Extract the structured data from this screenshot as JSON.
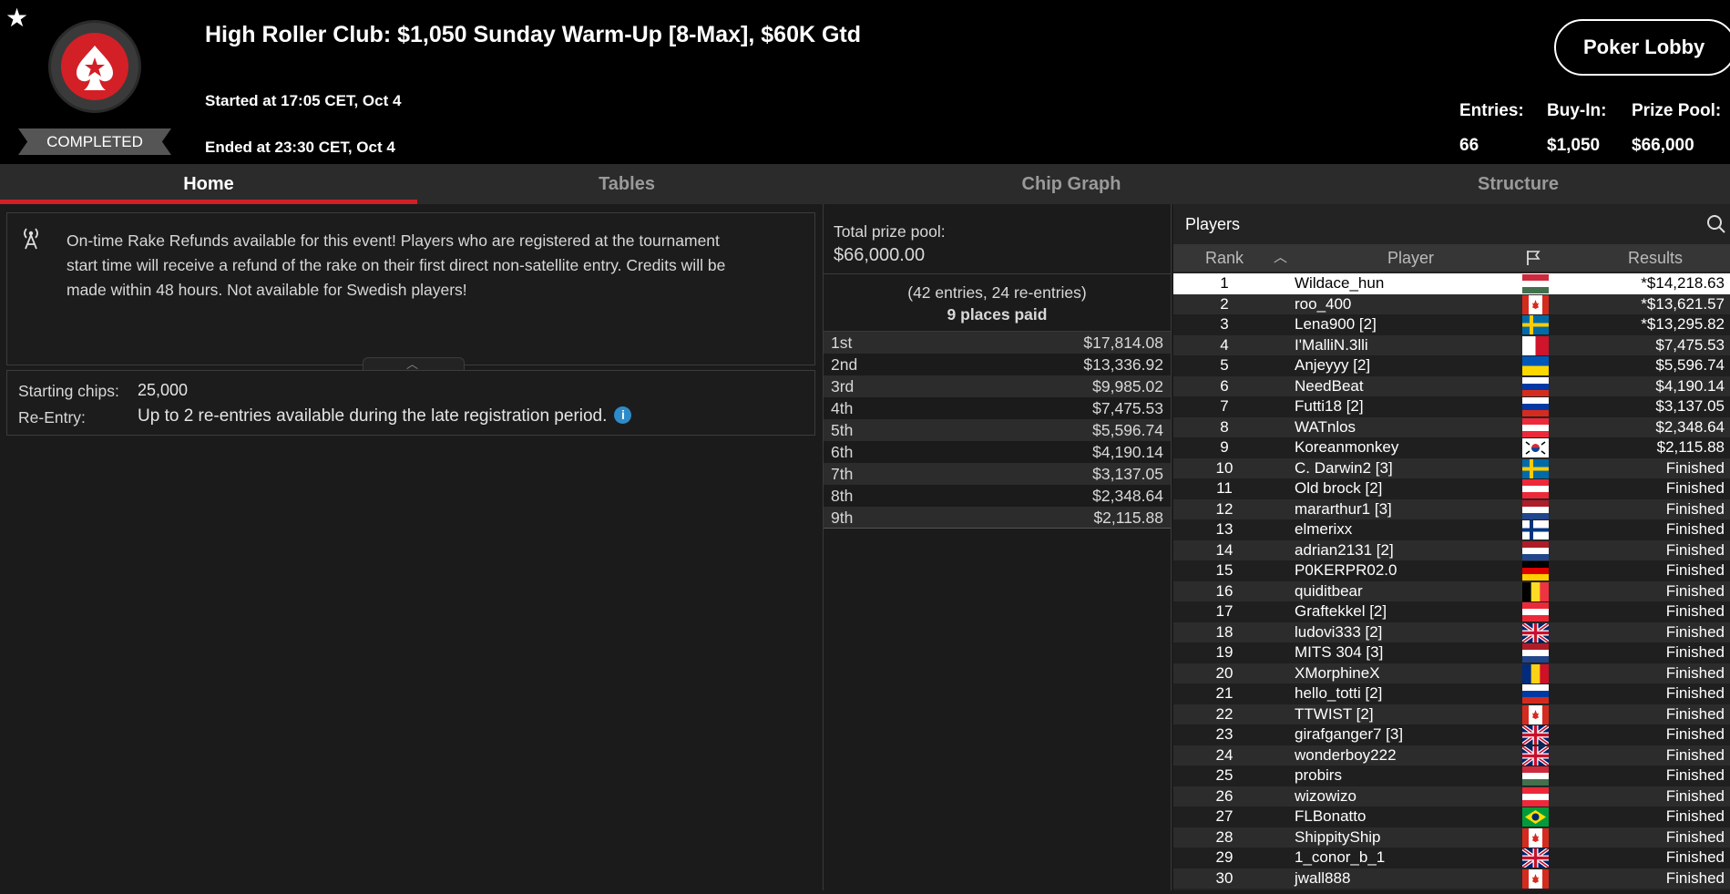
{
  "header": {
    "title": "High Roller Club: $1,050 Sunday Warm-Up [8-Max], $60K Gtd",
    "started": "Started at 17:05 CET, Oct 4",
    "ended": "Ended at 23:30 CET, Oct 4",
    "status": "COMPLETED",
    "lobby_button": "Poker Lobby",
    "stats": {
      "entries_label": "Entries:",
      "entries_value": "66",
      "buyin_label": "Buy-In:",
      "buyin_value": "$1,050",
      "prizepool_label": "Prize Pool:",
      "prizepool_value": "$66,000"
    },
    "accent_color": "#d31f26"
  },
  "tabs": [
    {
      "label": "Home",
      "active": true
    },
    {
      "label": "Tables"
    },
    {
      "label": "Chip Graph"
    },
    {
      "label": "Structure"
    }
  ],
  "notice": {
    "icon": "antenna-icon",
    "lines": [
      "On-time Rake Refunds available for this event! Players who are registered at the tournament",
      "start time will receive a refund of the rake on their first direct non-satellite entry. Credits will be",
      "made within 48 hours. Not available for Swedish players!"
    ]
  },
  "details": {
    "starting_label": "Starting chips:",
    "starting_value": "25,000",
    "reentry_label": "Re-Entry:",
    "reentry_value": "Up to 2 re-entries available during the late registration period."
  },
  "prizes": {
    "total_label": "Total prize pool:",
    "total_value": "$66,000.00",
    "entries_note": "(42 entries, 24 re-entries)",
    "places_paid": "9 places paid",
    "rows": [
      {
        "place": "1st",
        "amount": "$17,814.08"
      },
      {
        "place": "2nd",
        "amount": "$13,336.92"
      },
      {
        "place": "3rd",
        "amount": "$9,985.02"
      },
      {
        "place": "4th",
        "amount": "$7,475.53"
      },
      {
        "place": "5th",
        "amount": "$5,596.74"
      },
      {
        "place": "6th",
        "amount": "$4,190.14"
      },
      {
        "place": "7th",
        "amount": "$3,137.05"
      },
      {
        "place": "8th",
        "amount": "$2,348.64"
      },
      {
        "place": "9th",
        "amount": "$2,115.88"
      }
    ]
  },
  "players": {
    "title": "Players",
    "columns": {
      "rank": "Rank",
      "player": "Player",
      "results": "Results"
    },
    "rows": [
      {
        "rank": "1",
        "name": "Wildace_hun",
        "flag": "hu",
        "result": "*$14,218.63"
      },
      {
        "rank": "2",
        "name": "roo_400",
        "flag": "ca",
        "result": "*$13,621.57"
      },
      {
        "rank": "3",
        "name": "Lena900 [2]",
        "flag": "se",
        "result": "*$13,295.82"
      },
      {
        "rank": "4",
        "name": "I'MalliN.3lli",
        "flag": "mt",
        "result": "$7,475.53"
      },
      {
        "rank": "5",
        "name": "Anjeyyy [2]",
        "flag": "ua",
        "result": "$5,596.74"
      },
      {
        "rank": "6",
        "name": "NeedBeat",
        "flag": "ru",
        "result": "$4,190.14"
      },
      {
        "rank": "7",
        "name": "Futti18 [2]",
        "flag": "ru",
        "result": "$3,137.05"
      },
      {
        "rank": "8",
        "name": "WATnlos",
        "flag": "at",
        "result": "$2,348.64"
      },
      {
        "rank": "9",
        "name": "Koreanmonkey",
        "flag": "kr",
        "result": "$2,115.88"
      },
      {
        "rank": "10",
        "name": "C. Darwin2 [3]",
        "flag": "se",
        "result": "Finished"
      },
      {
        "rank": "11",
        "name": "Old brock [2]",
        "flag": "at",
        "result": "Finished"
      },
      {
        "rank": "12",
        "name": "mararthur1 [3]",
        "flag": "nl",
        "result": "Finished"
      },
      {
        "rank": "13",
        "name": "elmerixx",
        "flag": "fi",
        "result": "Finished"
      },
      {
        "rank": "14",
        "name": "adrian2131 [2]",
        "flag": "nl",
        "result": "Finished"
      },
      {
        "rank": "15",
        "name": "P0KERPR02.0",
        "flag": "de",
        "result": "Finished"
      },
      {
        "rank": "16",
        "name": "quiditbear",
        "flag": "be",
        "result": "Finished"
      },
      {
        "rank": "17",
        "name": "Graftekkel [2]",
        "flag": "at",
        "result": "Finished"
      },
      {
        "rank": "18",
        "name": "ludovi333 [2]",
        "flag": "gb",
        "result": "Finished"
      },
      {
        "rank": "19",
        "name": "MITS 304 [3]",
        "flag": "nl",
        "result": "Finished"
      },
      {
        "rank": "20",
        "name": "XMorphineX",
        "flag": "ro",
        "result": "Finished"
      },
      {
        "rank": "21",
        "name": "hello_totti [2]",
        "flag": "ru",
        "result": "Finished"
      },
      {
        "rank": "22",
        "name": "TTWIST [2]",
        "flag": "ca",
        "result": "Finished"
      },
      {
        "rank": "23",
        "name": "girafganger7 [3]",
        "flag": "gb",
        "result": "Finished"
      },
      {
        "rank": "24",
        "name": "wonderboy222",
        "flag": "gb",
        "result": "Finished"
      },
      {
        "rank": "25",
        "name": "probirs",
        "flag": "hu",
        "result": "Finished"
      },
      {
        "rank": "26",
        "name": "wizowizo",
        "flag": "at",
        "result": "Finished"
      },
      {
        "rank": "27",
        "name": "FLBonatto",
        "flag": "br",
        "result": "Finished"
      },
      {
        "rank": "28",
        "name": "ShippityShip",
        "flag": "ca",
        "result": "Finished"
      },
      {
        "rank": "29",
        "name": "1_conor_b_1",
        "flag": "gb",
        "result": "Finished"
      },
      {
        "rank": "30",
        "name": "jwall888",
        "flag": "ca",
        "result": "Finished"
      }
    ]
  }
}
